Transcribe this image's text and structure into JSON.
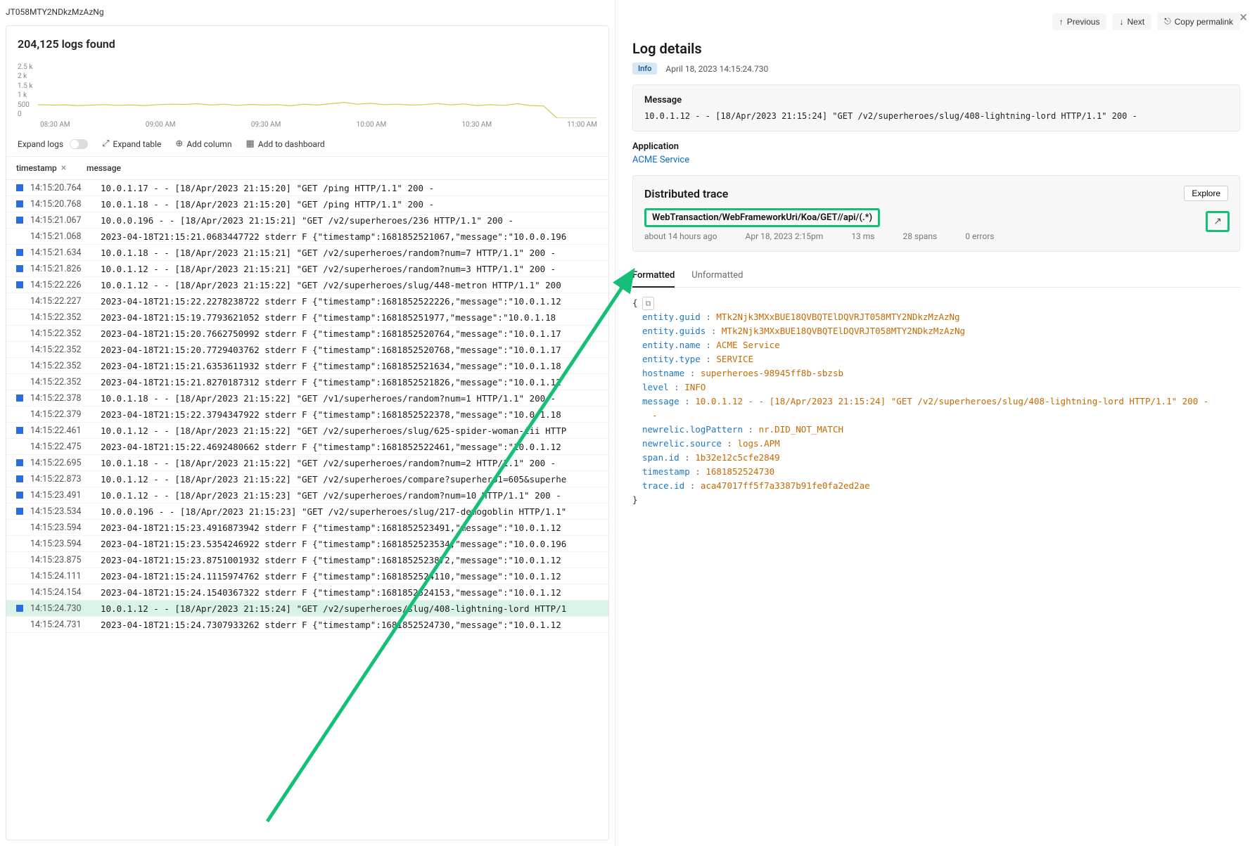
{
  "breadcrumb": "JT058MTY2NDkzMzAzNg",
  "results_count_label": "204,125 logs found",
  "chart_data": {
    "type": "line",
    "y_ticks": [
      "2.5 k",
      "2 k",
      "1.5 k",
      "1 k",
      "500",
      "0"
    ],
    "x_ticks": [
      "08:30 AM",
      "09:00 AM",
      "09:30 AM",
      "10:00 AM",
      "10:30 AM",
      "11:00 AM"
    ],
    "ylim": [
      0,
      2500
    ],
    "values": [
      600,
      580,
      590,
      560,
      580,
      600,
      570,
      590,
      560,
      600,
      620,
      610,
      640,
      580,
      620,
      570,
      610,
      580,
      600,
      550,
      620,
      580,
      640,
      700,
      620,
      660,
      600,
      620,
      580,
      600,
      650,
      590,
      630,
      560,
      600,
      570,
      640,
      560,
      540,
      0,
      0,
      0,
      0
    ]
  },
  "toolbar": {
    "expand_logs": "Expand logs",
    "expand_table": "Expand table",
    "add_column": "Add column",
    "add_dashboard": "Add to dashboard"
  },
  "columns": {
    "timestamp": "timestamp",
    "message": "message"
  },
  "log_rows": [
    {
      "ts": "14:15:20.764",
      "blue": true,
      "msg": "10.0.1.17 - - [18/Apr/2023 21:15:20] \"GET /ping HTTP/1.1\" 200 -"
    },
    {
      "ts": "14:15:20.768",
      "blue": true,
      "msg": "10.0.1.18 - - [18/Apr/2023 21:15:20] \"GET /ping HTTP/1.1\" 200 -"
    },
    {
      "ts": "14:15:21.067",
      "blue": true,
      "msg": "10.0.0.196 - - [18/Apr/2023 21:15:21] \"GET /v2/superheroes/236 HTTP/1.1\" 200 -"
    },
    {
      "ts": "14:15:21.068",
      "blue": false,
      "msg": "2023-04-18T21:15:21.0683447722 stderr F {\"timestamp\":1681852521067,\"message\":\"10.0.0.196"
    },
    {
      "ts": "14:15:21.634",
      "blue": true,
      "msg": "10.0.1.18 - - [18/Apr/2023 21:15:21] \"GET /v2/superheroes/random?num=7 HTTP/1.1\" 200 -"
    },
    {
      "ts": "14:15:21.826",
      "blue": true,
      "msg": "10.0.1.12 - - [18/Apr/2023 21:15:21] \"GET /v2/superheroes/random?num=3 HTTP/1.1\" 200 -"
    },
    {
      "ts": "14:15:22.226",
      "blue": true,
      "msg": "10.0.1.12 - - [18/Apr/2023 21:15:22] \"GET /v2/superheroes/slug/448-metron HTTP/1.1\" 200"
    },
    {
      "ts": "14:15:22.227",
      "blue": false,
      "msg": "2023-04-18T21:15:22.2278238722 stderr F {\"timestamp\":1681852522226,\"message\":\"10.0.1.12"
    },
    {
      "ts": "14:15:22.352",
      "blue": false,
      "msg": "2023-04-18T21:15:19.7793621052 stderr F {\"timestamp\":168185251977,\"message\":\"10.0.1.18"
    },
    {
      "ts": "14:15:22.352",
      "blue": false,
      "msg": "2023-04-18T21:15:20.7662750992 stderr F {\"timestamp\":1681852520764,\"message\":\"10.0.1.17"
    },
    {
      "ts": "14:15:22.352",
      "blue": false,
      "msg": "2023-04-18T21:15:20.7729403762 stderr F {\"timestamp\":1681852520768,\"message\":\"10.0.1.17"
    },
    {
      "ts": "14:15:22.352",
      "blue": false,
      "msg": "2023-04-18T21:15:21.6353611932 stderr F {\"timestamp\":1681852521634,\"message\":\"10.0.1.18"
    },
    {
      "ts": "14:15:22.352",
      "blue": false,
      "msg": "2023-04-18T21:15:21.8270187312 stderr F {\"timestamp\":1681852521826,\"message\":\"10.0.1.12"
    },
    {
      "ts": "14:15:22.378",
      "blue": true,
      "msg": "10.0.1.18 - - [18/Apr/2023 21:15:22] \"GET /v1/superheroes/random?num=1 HTTP/1.1\" 200 -"
    },
    {
      "ts": "14:15:22.379",
      "blue": false,
      "msg": "2023-04-18T21:15:22.3794347922 stderr F {\"timestamp\":1681852522378,\"message\":\"10.0.1.18"
    },
    {
      "ts": "14:15:22.461",
      "blue": true,
      "msg": "10.0.1.12 - - [18/Apr/2023 21:15:22] \"GET /v2/superheroes/slug/625-spider-woman-iii HTTP"
    },
    {
      "ts": "14:15:22.475",
      "blue": false,
      "msg": "2023-04-18T21:15:22.4692480662 stderr F {\"timestamp\":1681852522461,\"message\":\"10.0.1.12"
    },
    {
      "ts": "14:15:22.695",
      "blue": true,
      "msg": "10.0.1.18 - - [18/Apr/2023 21:15:22] \"GET /v2/superheroes/random?num=2 HTTP/1.1\" 200 -"
    },
    {
      "ts": "14:15:22.873",
      "blue": true,
      "msg": "10.0.1.12 - - [18/Apr/2023 21:15:22] \"GET /v2/superheroes/compare?superhero1=605&superhe"
    },
    {
      "ts": "14:15:23.491",
      "blue": true,
      "msg": "10.0.1.12 - - [18/Apr/2023 21:15:23] \"GET /v2/superheroes/random?num=10 HTTP/1.1\" 200 -"
    },
    {
      "ts": "14:15:23.534",
      "blue": true,
      "msg": "10.0.0.196 - - [18/Apr/2023 21:15:23] \"GET /v2/superheroes/slug/217-demogoblin HTTP/1.1\""
    },
    {
      "ts": "14:15:23.594",
      "blue": false,
      "msg": "2023-04-18T21:15:23.4916873942 stderr F {\"timestamp\":1681852523491,\"message\":\"10.0.1.12"
    },
    {
      "ts": "14:15:23.594",
      "blue": false,
      "msg": "2023-04-18T21:15:23.5354246922 stderr F {\"timestamp\":1681852523534,\"message\":\"10.0.0.196"
    },
    {
      "ts": "14:15:23.875",
      "blue": false,
      "msg": "2023-04-18T21:15:23.8751001932 stderr F {\"timestamp\":1681852523872,\"message\":\"10.0.1.12"
    },
    {
      "ts": "14:15:24.111",
      "blue": false,
      "msg": "2023-04-18T21:15:24.1115974762 stderr F {\"timestamp\":1681852524110,\"message\":\"10.0.1.12"
    },
    {
      "ts": "14:15:24.154",
      "blue": false,
      "msg": "2023-04-18T21:15:24.1540367322 stderr F {\"timestamp\":1681852524153,\"message\":\"10.0.1.12"
    },
    {
      "ts": "14:15:24.730",
      "blue": true,
      "selected": true,
      "msg": "10.0.1.12 - - [18/Apr/2023 21:15:24] \"GET /v2/superheroes/slug/408-lightning-lord HTTP/1"
    },
    {
      "ts": "14:15:24.731",
      "blue": false,
      "msg": "2023-04-18T21:15:24.7307933262 stderr F {\"timestamp\":1681852524730,\"message\":\"10.0.1.12"
    }
  ],
  "details": {
    "actions": {
      "previous": "Previous",
      "next": "Next",
      "copy": "Copy permalink"
    },
    "title": "Log details",
    "level_badge": "Info",
    "timestamp": "April 18, 2023 14:15:24.730",
    "message_heading": "Message",
    "message_body": "10.0.1.12 - - [18/Apr/2023 21:15:24] \"GET /v2/superheroes/slug/408-lightning-lord HTTP/1.1\" 200 -",
    "application_heading": "Application",
    "application_name": "ACME Service",
    "trace": {
      "heading": "Distributed trace",
      "explore": "Explore",
      "name": "WebTransaction/WebFrameworkUri/Koa/GET//api/(.*)",
      "age": "about 14 hours ago",
      "datetime": "Apr 18, 2023 2:15pm",
      "duration": "13 ms",
      "spans": "28 spans",
      "errors": "0 errors"
    },
    "tabs": {
      "formatted": "Formatted",
      "unformatted": "Unformatted"
    },
    "json_kv": [
      {
        "k": "entity.guid",
        "v": "MTk2Njk3MXxBUE18QVBQTElDQVRJT058MTY2NDkzMzAzNg"
      },
      {
        "k": "entity.guids",
        "v": "MTk2Njk3MXxBUE18QVBQTElDQVRJT058MTY2NDkzMzAzNg"
      },
      {
        "k": "entity.name",
        "v": "ACME Service"
      },
      {
        "k": "entity.type",
        "v": "SERVICE"
      },
      {
        "k": "hostname",
        "v": "superheroes-98945ff8b-sbzsb"
      },
      {
        "k": "level",
        "v": "INFO"
      },
      {
        "k": "message",
        "v": "10.0.1.12 - - [18/Apr/2023 21:15:24] \"GET /v2/superheroes/slug/408-lightning-lord HTTP/1.1\" 200 -"
      },
      {
        "k": "newrelic.logPattern",
        "v": "nr.DID_NOT_MATCH"
      },
      {
        "k": "newrelic.source",
        "v": "logs.APM"
      },
      {
        "k": "span.id",
        "v": "1b32e12c5cfe2849"
      },
      {
        "k": "timestamp",
        "v": "1681852524730"
      },
      {
        "k": "trace.id",
        "v": "aca47017ff5f7a3387b91fe0fa2ed2ae"
      }
    ]
  }
}
